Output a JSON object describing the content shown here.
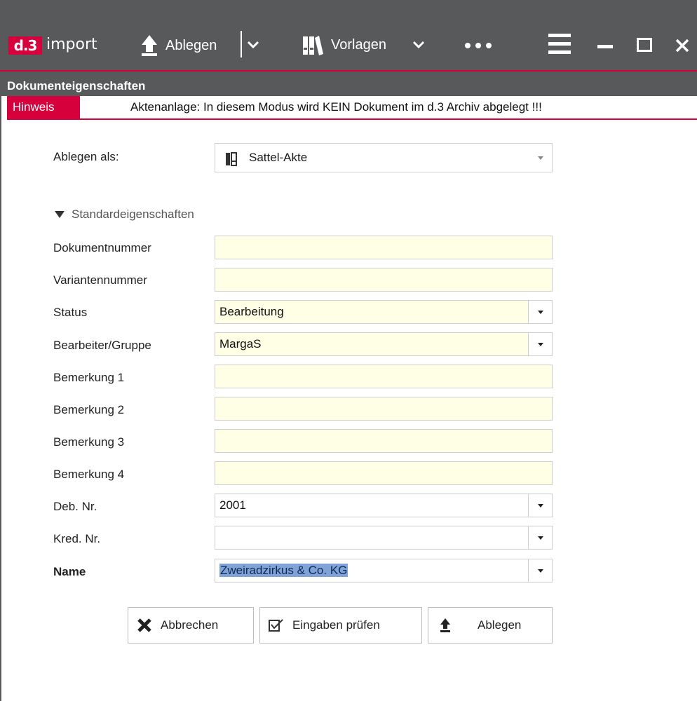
{
  "titlebar": {
    "logo_badge": "d.3",
    "logo_text": "import",
    "ablegen_label": "Ablegen",
    "vorlagen_label": "Vorlagen"
  },
  "section": {
    "title": "Dokumenteigenschaften",
    "hint_label": "Hinweis",
    "hint_text": "Aktenanlage: In diesem Modus wird KEIN Dokument im d.3 Archiv abgelegt !!!"
  },
  "form": {
    "ablegen_als_label": "Ablegen als:",
    "ablegen_als_value": "Sattel-Akte",
    "group_label": "Standardeigenschaften",
    "fields": [
      {
        "label": "Dokumentnummer",
        "value": ""
      },
      {
        "label": "Variantennummer",
        "value": ""
      },
      {
        "label": "Status",
        "value": "Bearbeitung"
      },
      {
        "label": "Bearbeiter/Gruppe",
        "value": "MargaS"
      },
      {
        "label": "Bemerkung 1",
        "value": ""
      },
      {
        "label": "Bemerkung 2",
        "value": ""
      },
      {
        "label": "Bemerkung 3",
        "value": ""
      },
      {
        "label": "Bemerkung 4",
        "value": ""
      },
      {
        "label": "Deb. Nr.",
        "value": "2001"
      },
      {
        "label": "Kred. Nr.",
        "value": ""
      },
      {
        "label": "Name",
        "value": "Zweiradzirkus & Co. KG"
      }
    ]
  },
  "buttons": {
    "cancel": "Abbrechen",
    "check": "Eingaben prüfen",
    "save": "Ablegen"
  },
  "colors": {
    "accent": "#d5003c",
    "titlebar_bg": "#58595b",
    "required_field_bg": "#ffffe6",
    "selection_bg": "#7fa3d6"
  }
}
